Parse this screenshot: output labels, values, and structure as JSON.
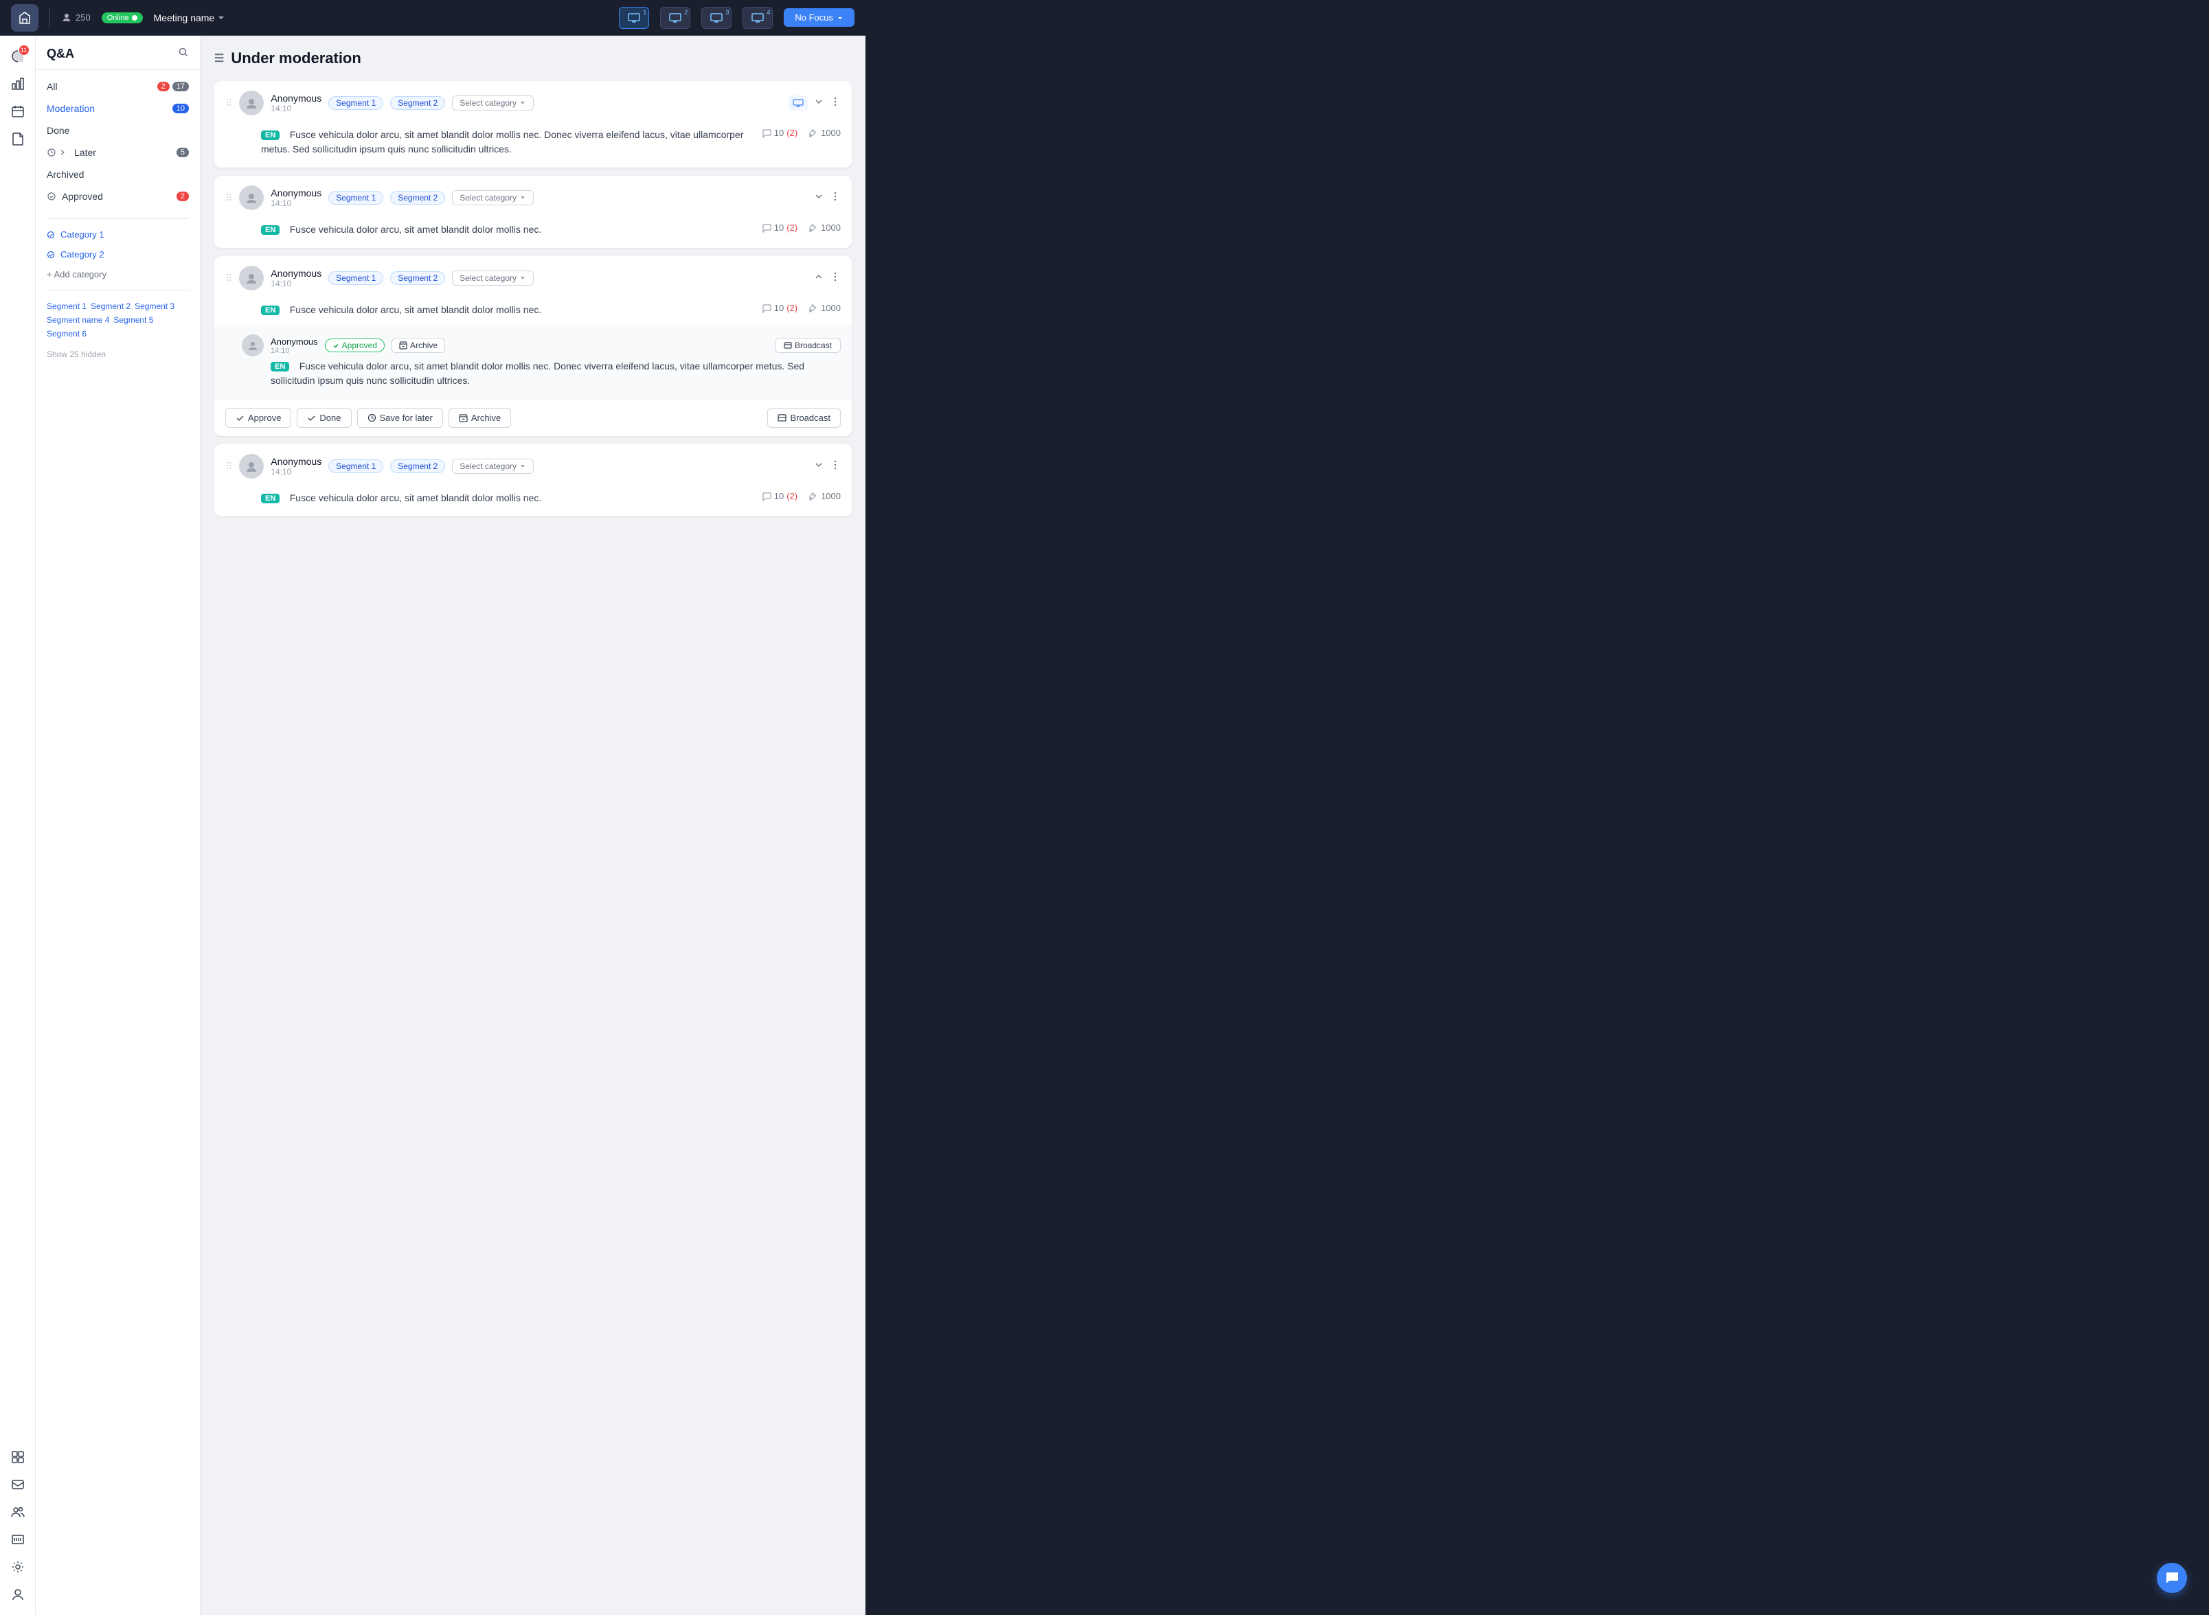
{
  "topnav": {
    "logo": "A",
    "attendees": "250",
    "online_label": "Online",
    "meeting_name": "Meeting name",
    "no_focus_label": "No Focus",
    "monitors": [
      "1",
      "2",
      "3",
      "4"
    ]
  },
  "sidebar": {
    "notification_count": "11",
    "qa_title": "Q&A",
    "nav_items": [
      {
        "label": "All",
        "badge_red": "2",
        "badge_gray": "17",
        "active": false
      },
      {
        "label": "Moderation",
        "badge_blue": "10",
        "active": true
      },
      {
        "label": "Done",
        "active": false
      },
      {
        "label": "Later",
        "badge_gray": "5",
        "active": false
      },
      {
        "label": "Archived",
        "active": false
      },
      {
        "label": "Approved",
        "badge_red": "2",
        "active": false
      }
    ],
    "categories": [
      {
        "label": "Category 1"
      },
      {
        "label": "Category 2"
      }
    ],
    "add_category": "+ Add category",
    "segments": [
      "Segment 1",
      "Segment 2",
      "Segment 3",
      "Segment name 4",
      "Segment 5",
      "Segment 6"
    ],
    "show_hidden": "Show 25 hidden"
  },
  "main": {
    "title": "Under moderation",
    "questions": [
      {
        "id": 1,
        "author": "Anonymous",
        "time": "14:10",
        "segments": [
          "Segment 1",
          "Segment 2"
        ],
        "category_placeholder": "Select category",
        "has_monitor": true,
        "text": "Fusce vehicula dolor arcu, sit amet blandit dolor mollis nec. Donec viverra eleifend lacus, vitae ullamcorper metus. Sed sollicitudin ipsum quis nunc sollicitudin ultrices.",
        "lang": "EN",
        "comments": "10",
        "comments_new": "(2)",
        "likes": "1000",
        "expanded": false,
        "chevron": "down"
      },
      {
        "id": 2,
        "author": "Anonymous",
        "time": "14:10",
        "segments": [
          "Segment 1",
          "Segment 2"
        ],
        "category_placeholder": "Select category",
        "has_monitor": false,
        "text": "Fusce vehicula dolor arcu, sit amet blandit dolor mollis nec.",
        "lang": "EN",
        "comments": "10",
        "comments_new": "(2)",
        "likes": "1000",
        "expanded": false,
        "chevron": "down"
      },
      {
        "id": 3,
        "author": "Anonymous",
        "time": "14:10",
        "segments": [
          "Segment 1",
          "Segment 2"
        ],
        "category_placeholder": "Select category",
        "has_monitor": false,
        "text": "Fusce vehicula dolor arcu, sit amet blandit dolor mollis nec.",
        "lang": "EN",
        "comments": "10",
        "comments_new": "(2)",
        "likes": "1000",
        "expanded": true,
        "chevron": "up",
        "sub_question": {
          "author": "Anonymous",
          "time": "14:10",
          "approved_label": "Approved",
          "archive_label": "Archive",
          "broadcast_label": "Broadcast",
          "text": "Fusce vehicula dolor arcu, sit amet blandit dolor mollis nec. Donec viverra eleifend lacus, vitae ullamcorper metus. Sed sollicitudin ipsum quis nunc sollicitudin ultrices.",
          "lang": "EN"
        },
        "action_bar": {
          "approve_label": "Approve",
          "done_label": "Done",
          "save_later_label": "Save for later",
          "archive_label": "Archive",
          "broadcast_label": "Broadcast"
        }
      },
      {
        "id": 4,
        "author": "Anonymous",
        "time": "14:10",
        "segments": [
          "Segment 1",
          "Segment 2"
        ],
        "category_placeholder": "Select category",
        "has_monitor": false,
        "text": "Fusce vehicula dolor arcu, sit amet blandit dolor mollis nec.",
        "lang": "EN",
        "comments": "10",
        "comments_new": "(2)",
        "likes": "1000",
        "expanded": false,
        "chevron": "down"
      }
    ]
  }
}
